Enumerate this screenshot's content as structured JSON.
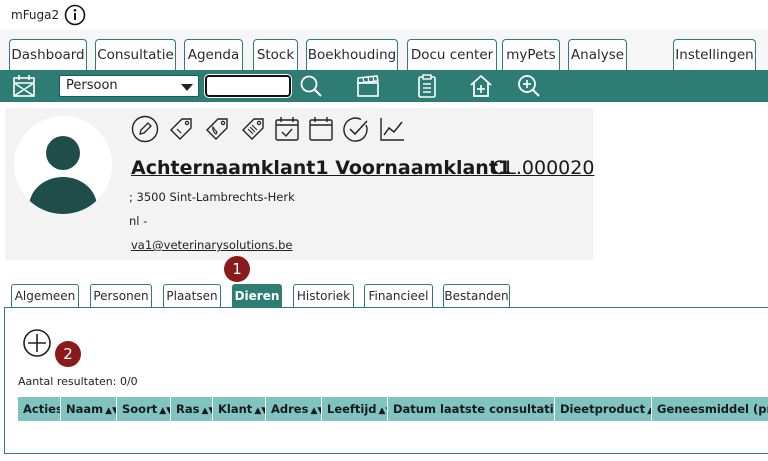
{
  "app": {
    "title": "mFuga2"
  },
  "top_tabs": [
    "Dashboard",
    "Consultatie",
    "Agenda",
    "Stock",
    "Boekhouding",
    "Docu center",
    "myPets",
    "Analyse",
    "Instellingen"
  ],
  "toolbar": {
    "select_value": "Persoon",
    "search_value": "",
    "icons": [
      "calendar-grid-icon",
      "search-icon",
      "clapperboard-icon",
      "clipboard-icon",
      "home-add-icon",
      "zoom-in-icon"
    ]
  },
  "client": {
    "name": "Achternaamklant1 Voornaamklant1",
    "code": "CL.000020",
    "address": "; 3500 Sint-Lambrechts-Herk",
    "language": "nl -",
    "email": "va1@veterinarysolutions.be",
    "action_icons": [
      "edit-icon",
      "tag-icon",
      "phone-tag-icon",
      "barcode-tag-icon",
      "calendar-check-icon",
      "calendar-icon",
      "check-circle-icon",
      "line-chart-icon"
    ]
  },
  "markers": [
    "1",
    "2"
  ],
  "sub_tabs": [
    "Algemeen",
    "Personen",
    "Plaatsen",
    "Dieren",
    "Historiek",
    "Financieel",
    "Bestanden"
  ],
  "active_sub_tab": "Dieren",
  "results": {
    "label": "Aantal resultaten: 0/0"
  },
  "table": {
    "columns": [
      "Acties",
      "Naam",
      "Soort",
      "Ras",
      "Klant",
      "Adres",
      "Leeftijd",
      "Datum laatste consultatie",
      "Dieetproduct",
      "Geneesmiddel (prod"
    ],
    "rows": []
  },
  "colors": {
    "accent": "#2e7d74",
    "table_header": "#7fc4c0",
    "marker": "#8b1a1a"
  }
}
